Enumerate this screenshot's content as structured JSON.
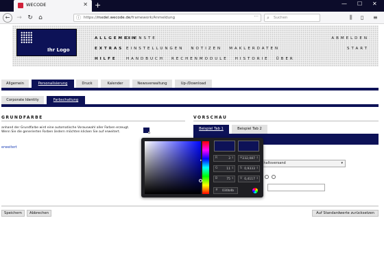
{
  "browser": {
    "tab_title": "WECODE",
    "url_prefix": "https://",
    "url_domain": "mxdel.wecode.de",
    "url_path": "/framework/Anmeldung",
    "search_placeholder": "Suchen"
  },
  "header": {
    "logo_text": "Ihr Logo",
    "rows": [
      {
        "label": "ALLGEMEIN",
        "items": [
          "DIENSTE"
        ],
        "right": "ABMELDEN"
      },
      {
        "label": "EXTRAS",
        "items": [
          "EINSTELLUNGEN",
          "NOTIZEN",
          "MAKLERDATEN"
        ],
        "right": "START"
      },
      {
        "label": "HILFE",
        "items": [
          "HANDBUCH",
          "RECHENMODULE",
          "HISTORIE",
          "ÜBER"
        ],
        "right": ""
      }
    ]
  },
  "main_tabs": [
    "Allgemein",
    "Personalisierung",
    "Druck",
    "Kalender",
    "Newsverwaltung",
    "Up-/Download"
  ],
  "sub_tabs": [
    "Corporate Identity",
    "Farbschaltung"
  ],
  "grundfarbe": {
    "title": "GRUNDFARBE",
    "description": "anhand der Grundfarbe wird eine automatische Vorauswahl aller Farben erzeugt. Wenn Sie die generierten Farben ändern möchten klicken Sie auf erweitert.",
    "advanced_link": "erweitert",
    "color": "#0d1257"
  },
  "vorschau": {
    "title": "VORSCHAU",
    "tabs": [
      "Beispiel Tab 1",
      "Beispiel Tab 2"
    ],
    "select_value": "...shaltsversand"
  },
  "color_picker": {
    "fields_left": [
      {
        "key": "R",
        "value": "3"
      },
      {
        "key": "G",
        "value": "11"
      },
      {
        "key": "B",
        "value": "75"
      }
    ],
    "fields_right": [
      {
        "key": "H",
        "value": "232,087"
      },
      {
        "key": "S",
        "value": "0,9333"
      },
      {
        "key": "V",
        "value": "0,4117"
      }
    ],
    "hex": "030b4b"
  },
  "buttons": {
    "save": "Speichern",
    "cancel": "Abbrechen",
    "reset": "Auf Standardwerte zurücksetzen"
  }
}
